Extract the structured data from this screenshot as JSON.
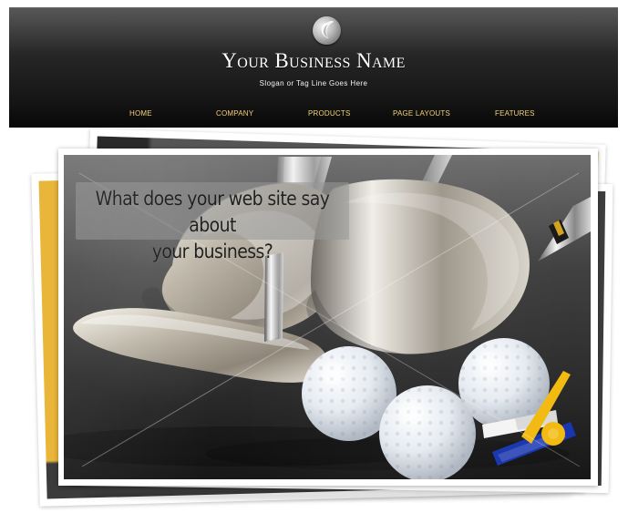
{
  "header": {
    "business_name": "Your Business Name",
    "slogan": "Slogan or Tag Line Goes Here",
    "logo_icon": "leaf-swirl-icon"
  },
  "nav": {
    "items": [
      {
        "label": "HOME"
      },
      {
        "label": "COMPANY"
      },
      {
        "label": "PRODUCTS"
      },
      {
        "label": "PAGE LAYOUTS"
      },
      {
        "label": "FEATURES"
      }
    ],
    "accent_color": "#f5d173"
  },
  "hero": {
    "headline_line1": "What does your web site say about",
    "headline_line2": "your business?",
    "image_name": "golf-clubs-and-golf-balls-image"
  },
  "colors": {
    "header_background": "#151515",
    "gold_accent": "#e7b236",
    "white": "#ffffff"
  }
}
